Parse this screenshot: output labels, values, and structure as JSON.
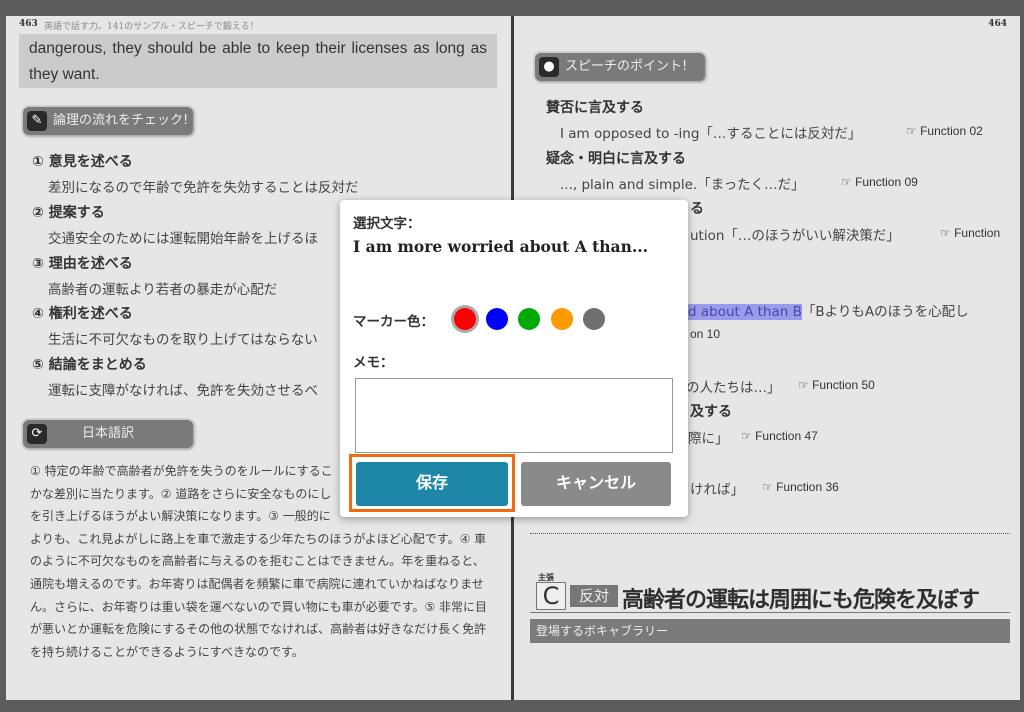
{
  "left_page": {
    "page_number": "463",
    "running_head": "英語で話す力。141のサンプル・スピーチで鍛える！",
    "quote": "dangerous, they should be able to keep their licenses as long as they want.",
    "logic_badge": "論理の流れをチェック!",
    "logic_items": [
      {
        "heading": "① 意見を述べる",
        "text": "差別になるので年齢で免許を失効することは反対だ"
      },
      {
        "heading": "② 提案する",
        "text": "交通安全のためには運転開始年齢を上げるほ"
      },
      {
        "heading": "③ 理由を述べる",
        "text": "高齢者の運転より若者の暴走が心配だ"
      },
      {
        "heading": "④ 権利を述べる",
        "text": "生活に不可欠なものを取り上げてはならない"
      },
      {
        "heading": "⑤ 結論をまとめる",
        "text": "運転に支障がなければ、免許を失効させるべ"
      }
    ],
    "translation_badge": "日本語訳",
    "translation_lines": [
      "① 特定の年齢で高齢者が免許を失うのをルールにするこ",
      "かな差別に当たります。② 道路をさらに安全なものにし",
      "を引き上げるほうがよい解決策になります。③ 一般的に",
      "よりも、これ見よがしに路上を車で激走する少年たちのほうがよほど心配です。④ 車",
      "のように不可欠なものを高齢者に与えるのを拒むことはできません。年を重ねると、",
      "通院も増えるのです。お年寄りは配偶者を頻繁に車で病院に連れていかねばなりませ",
      "ん。さらに、お年寄りは重い袋を運べないので買い物にも車が必要です。⑤ 非常に目",
      "が悪いとか運転を危険にするその他の状態でなければ、高齢者は好きなだけ長く免許",
      "を持ち続けることができるようにすべきなのです。"
    ]
  },
  "right_page": {
    "page_number": "464",
    "points_badge": "スピーチのポイント!",
    "h1": "賛否に言及する",
    "l1": "I am opposed to -ing「…することには反対だ」",
    "f1": "☞ Function 02",
    "h2": "疑念・明白に言及する",
    "l2": "..., plain and simple.「まったく…だ」",
    "f2": "☞ Function 09",
    "h3": "る",
    "l3": "ution「…のほうがいい解決策だ」",
    "f3": "☞ Function",
    "l4_hl": "d about A than B",
    "l4": "「BよりもAのほうを心配し",
    "f4": "on 10",
    "l5": "の人たちは…」",
    "f5": "☞ Function 50",
    "h6": "言及する",
    "l6": "際に」",
    "f6": "☞ Function 47",
    "l7": "ければ」",
    "f7": "☞ Function 36",
    "claim_ruby": "主張",
    "claim_letter": "C",
    "claim_tag": "反対",
    "claim_title": "高齢者の運転は周囲にも危険を及ぼす",
    "vocab_bar": "登場するボキャブラリー"
  },
  "dialog": {
    "selected_label": "選択文字：",
    "selected_text": "I am more worried about A than...",
    "marker_label": "マーカー色：",
    "marker_colors": [
      "#ff0000",
      "#0000ff",
      "#00aa00",
      "#ff9900",
      "#707070"
    ],
    "selected_color": "#ff0000",
    "memo_label": "メモ：",
    "memo_value": "",
    "save_label": "保存",
    "cancel_label": "キャンセル",
    "save_color": "#1e87a8",
    "focus_outline_color": "#f06a10"
  }
}
